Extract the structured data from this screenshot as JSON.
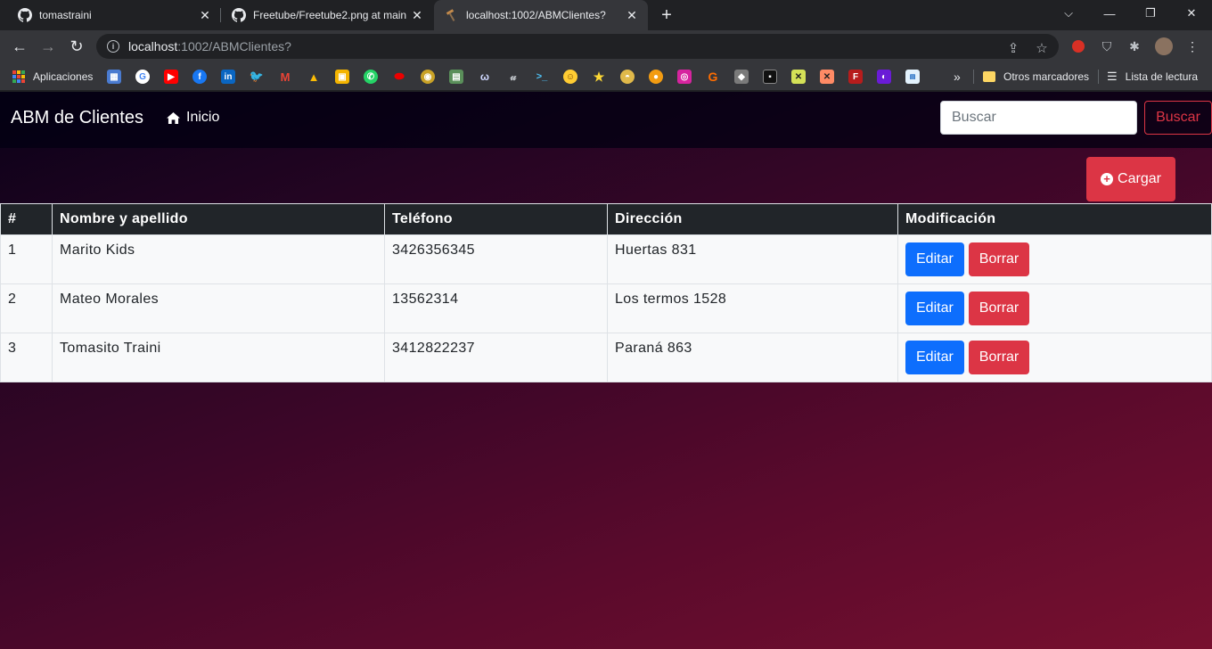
{
  "browser": {
    "tabs": [
      {
        "title": "tomastraini",
        "icon": "github-icon"
      },
      {
        "title": "Freetube/Freetube2.png at main",
        "icon": "github-icon"
      },
      {
        "title": "localhost:1002/ABMClientes?",
        "icon": "hammer-icon"
      }
    ],
    "url_host": "localhost",
    "url_rest": ":1002/ABMClientes?",
    "bookmarks": {
      "apps_label": "Aplicaciones",
      "other_label": "Otros marcadores",
      "reading_label": "Lista de lectura",
      "overflow": "»"
    }
  },
  "app": {
    "brand": "ABM de Clientes",
    "home_link": "Inicio",
    "search": {
      "placeholder": "Buscar",
      "button": "Buscar"
    },
    "add_button": "Cargar",
    "accent_danger": "#dc3545",
    "accent_primary": "#0d6efd",
    "table": {
      "headers": [
        "#",
        "Nombre y apellido",
        "Teléfono",
        "Dirección",
        "Modificación"
      ],
      "rows": [
        {
          "id": "1",
          "name": "Marito Kids",
          "phone": "3426356345",
          "address": "Huertas 831"
        },
        {
          "id": "2",
          "name": "Mateo Morales",
          "phone": "13562314",
          "address": "Los termos 1528"
        },
        {
          "id": "3",
          "name": "Tomasito Traini",
          "phone": "3412822237",
          "address": "Paraná 863"
        }
      ],
      "edit_label": "Editar",
      "delete_label": "Borrar"
    }
  }
}
